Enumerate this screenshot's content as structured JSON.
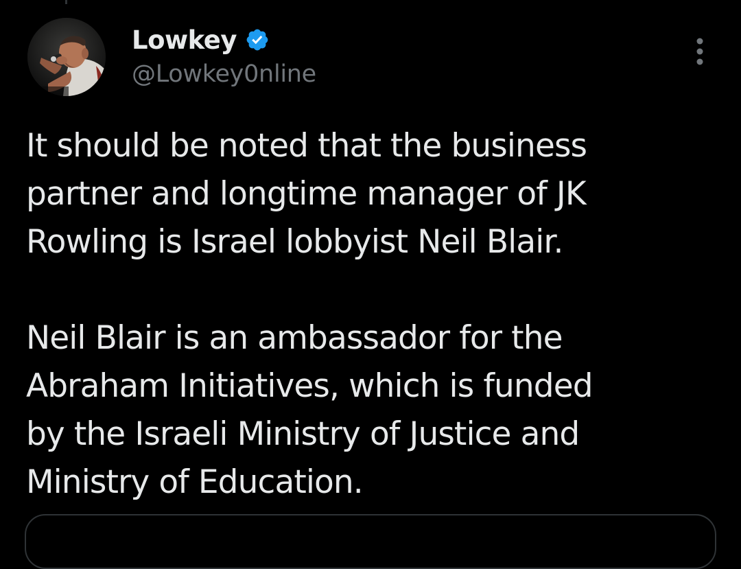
{
  "tweet": {
    "display_name": "Lowkey",
    "handle": "@Lowkey0nline",
    "verified": true,
    "paragraphs": [
      [
        "It should be noted that the business",
        "partner and longtime manager of JK",
        "Rowling is Israel lobbyist Neil Blair."
      ],
      [
        "Neil Blair is an ambassador for the",
        "Abraham Initiatives, which is funded",
        "by the Israeli Ministry of Justice and",
        "Ministry of Education."
      ]
    ]
  },
  "icons": {
    "verified": "verified-badge-icon",
    "more": "more-vertical-icon"
  },
  "colors": {
    "background": "#000000",
    "text_primary": "#e7e9ea",
    "text_secondary": "#71767b",
    "verified_blue": "#1d9bf0",
    "border": "#2f3336"
  }
}
